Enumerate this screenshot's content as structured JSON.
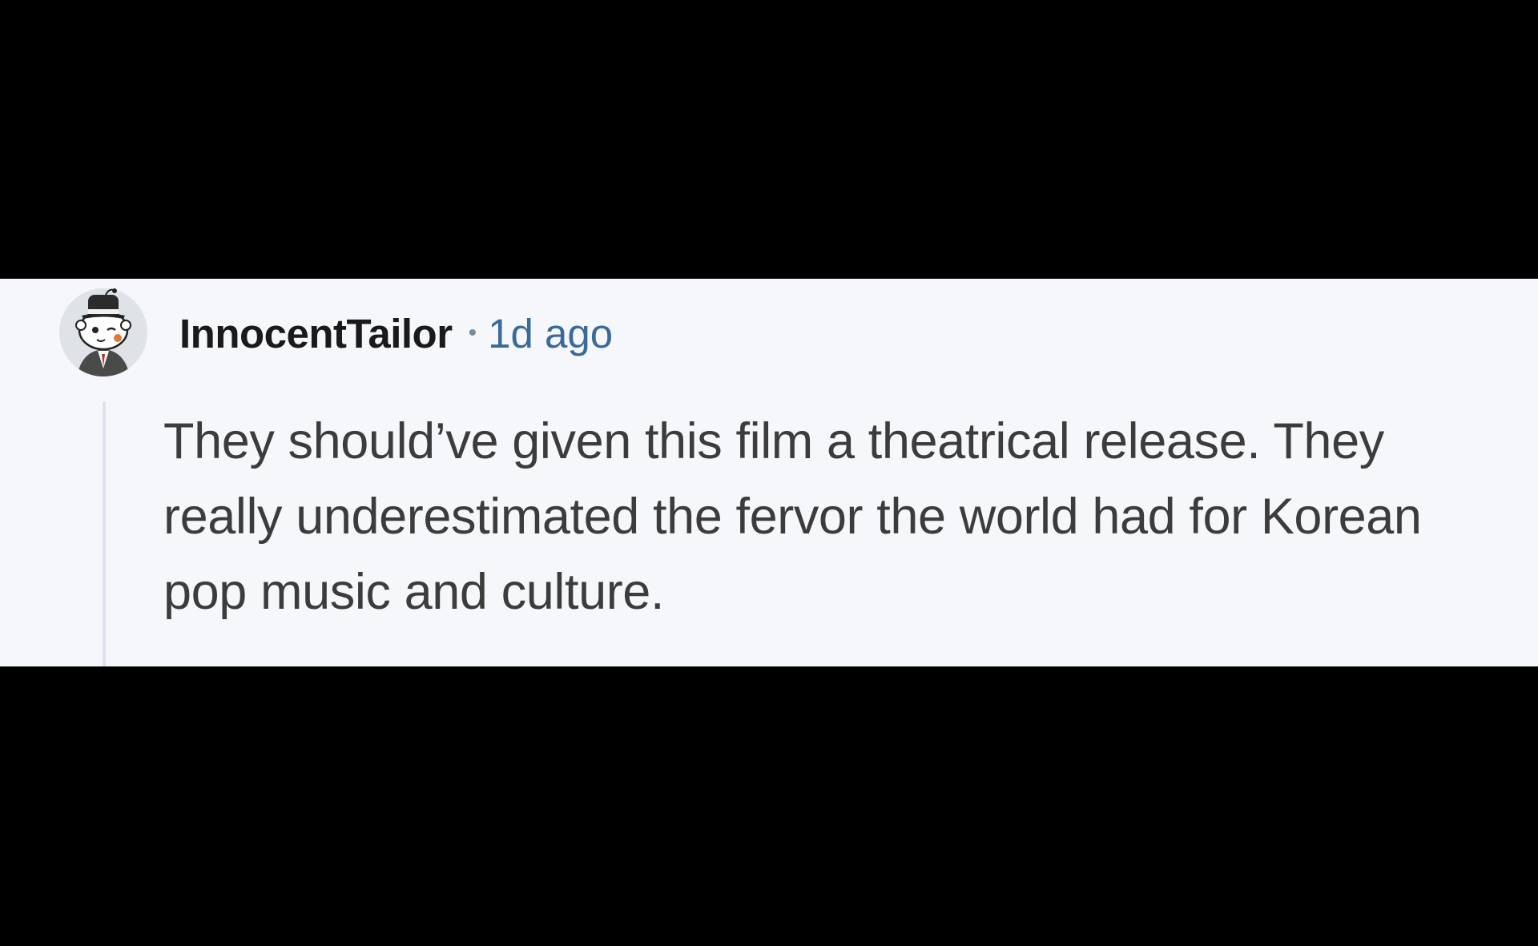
{
  "comment": {
    "avatar_icon": "snoo-avatar-icon",
    "username": "InnocentTailor",
    "separator": "•",
    "timestamp": "1d ago",
    "body": "They should’ve given this film a theatrical release. They really underestimated the fervor the world had for Korean pop music and culture."
  },
  "colors": {
    "page_background": "#000000",
    "card_background": "#f5f7fb",
    "username": "#1a1a1b",
    "timestamp": "#3a6a98",
    "body_text": "#3c3c3c",
    "thread_line": "#dde3ec"
  }
}
